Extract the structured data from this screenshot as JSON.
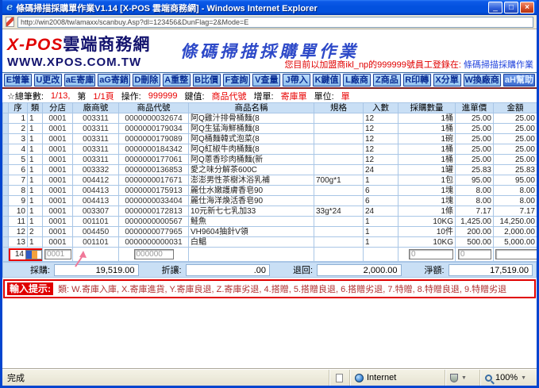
{
  "window": {
    "title": "條碼掃描採購單作業V1.14 [X-POS 雲端商務網] - Windows Internet Explorer",
    "minimize": "_",
    "maximize": "□",
    "close": "×"
  },
  "address": {
    "url": "http://win2008/tw/amaxx/scanbuy.Asp?dl=123456&DunFlag=2&Mode=E"
  },
  "header": {
    "logo_main_red": "X-POS",
    "logo_main_black": "雲端商務網",
    "logo_sub": "WWW.XPOS.COM.TW",
    "page_title": "條碼掃描採購單作業",
    "login_prefix": "您目前以加盟商ikl_np的999999號員工登錄在: ",
    "login_location": "條碼掃描採購作業"
  },
  "toolbar": {
    "buttons": [
      {
        "label": "E增筆"
      },
      {
        "label": "U更改"
      },
      {
        "label": "aE寄庫"
      },
      {
        "label": "aG寄銷"
      },
      {
        "label": "D刪除"
      },
      {
        "label": "A重整"
      },
      {
        "label": "B比價"
      },
      {
        "label": "F查詢"
      },
      {
        "label": "V查量"
      },
      {
        "label": "J帶入"
      },
      {
        "label": "K鍵值"
      },
      {
        "label": "L廠商"
      },
      {
        "label": "Z商品"
      },
      {
        "label": "R印轉"
      },
      {
        "label": "X分單"
      },
      {
        "label": "W換廠商"
      },
      {
        "label": "aH幫助",
        "cls": "help"
      }
    ]
  },
  "statusline": {
    "segments": [
      {
        "t": "☆總筆數:",
        "c": "k"
      },
      {
        "t": "1/13,",
        "c": "r"
      },
      {
        "t": "第",
        "c": "k"
      },
      {
        "t": "1/1頁",
        "c": "r"
      },
      {
        "t": "操作:",
        "c": "k"
      },
      {
        "t": "999999",
        "c": "r"
      },
      {
        "t": "鍵值:",
        "c": "k"
      },
      {
        "t": "商品代號",
        "c": "r"
      },
      {
        "t": "增單:",
        "c": "k"
      },
      {
        "t": "寄庫單",
        "c": "r"
      },
      {
        "t": "單位:",
        "c": "k"
      },
      {
        "t": "單",
        "c": "r"
      }
    ]
  },
  "table": {
    "headers": [
      "序",
      "類",
      "分店",
      "廠商號",
      "商品代號",
      "商品名稱",
      "規格",
      "入數",
      "採購數量",
      "進單價",
      "金額"
    ],
    "rows": [
      {
        "seq": "1",
        "type": "1",
        "store": "0001",
        "vendor": "003311",
        "code": "0000000032674",
        "name": "阿Q雞汁排骨桶麵(8",
        "spec": "",
        "innum": "12",
        "qty": "1桶",
        "price": "25.00",
        "amount": "25.00"
      },
      {
        "seq": "2",
        "type": "1",
        "store": "0001",
        "vendor": "003311",
        "code": "0000000179034",
        "name": "阿Q生猛海鮮桶麵(8",
        "spec": "",
        "innum": "12",
        "qty": "1桶",
        "price": "25.00",
        "amount": "25.00"
      },
      {
        "seq": "3",
        "type": "1",
        "store": "0001",
        "vendor": "003311",
        "code": "0000000179089",
        "name": "阿Q桶麵韓式泡菜(8",
        "spec": "",
        "innum": "12",
        "qty": "1碗",
        "price": "25.00",
        "amount": "25.00"
      },
      {
        "seq": "4",
        "type": "1",
        "store": "0001",
        "vendor": "003311",
        "code": "0000000184342",
        "name": "阿Q紅椒牛肉桶麵(8",
        "spec": "",
        "innum": "12",
        "qty": "1桶",
        "price": "25.00",
        "amount": "25.00"
      },
      {
        "seq": "5",
        "type": "1",
        "store": "0001",
        "vendor": "003311",
        "code": "0000000177061",
        "name": "阿Q蔥香珍肉桶麵(新",
        "spec": "",
        "innum": "12",
        "qty": "1桶",
        "price": "25.00",
        "amount": "25.00"
      },
      {
        "seq": "6",
        "type": "1",
        "store": "0001",
        "vendor": "003332",
        "code": "0000000136853",
        "name": "愛之味分解茶600C",
        "spec": "",
        "innum": "24",
        "qty": "1罐",
        "price": "25.83",
        "amount": "25.83"
      },
      {
        "seq": "7",
        "type": "1",
        "store": "0001",
        "vendor": "004412",
        "code": "0000000017671",
        "name": "澎澎男性茶樹沐浴乳補",
        "spec": "700g*1",
        "innum": "1",
        "qty": "1包",
        "price": "95.00",
        "amount": "95.00"
      },
      {
        "seq": "8",
        "type": "1",
        "store": "0001",
        "vendor": "004413",
        "code": "0000000175913",
        "name": "麗仕水嫩護膚香皂90",
        "spec": "",
        "innum": "6",
        "qty": "1塊",
        "price": "8.00",
        "amount": "8.00"
      },
      {
        "seq": "9",
        "type": "1",
        "store": "0001",
        "vendor": "004413",
        "code": "0000000033404",
        "name": "麗仕海洋煥活香皂90",
        "spec": "",
        "innum": "6",
        "qty": "1塊",
        "price": "8.00",
        "amount": "8.00"
      },
      {
        "seq": "10",
        "type": "1",
        "store": "0001",
        "vendor": "003307",
        "code": "0000000172813",
        "name": "10元新七七乳加33",
        "spec": "33g*24",
        "innum": "24",
        "qty": "1條",
        "price": "7.17",
        "amount": "7.17"
      },
      {
        "seq": "11",
        "type": "1",
        "store": "0001",
        "vendor": "001101",
        "code": "0000000000567",
        "name": "鮭魚",
        "spec": "",
        "innum": "1",
        "qty": "10KG",
        "price": "1,425.00",
        "amount": "14,250.00"
      },
      {
        "seq": "12",
        "type": "2",
        "store": "0001",
        "vendor": "004450",
        "code": "0000000077965",
        "name": "VH9604抽針V領",
        "spec": "",
        "innum": "1",
        "qty": "10件",
        "price": "200.00",
        "amount": "2,000.00"
      },
      {
        "seq": "13",
        "type": "1",
        "store": "0001",
        "vendor": "001101",
        "code": "0000000000031",
        "name": "白鯧",
        "spec": "",
        "innum": "1",
        "qty": "10KG",
        "price": "500.00",
        "amount": "5,000.00"
      }
    ]
  },
  "input_row": {
    "seq": "14",
    "type_value": "",
    "store": "0001",
    "code": "000000",
    "qty": "0",
    "price": "0"
  },
  "totals": {
    "purchase_label": "採購:",
    "purchase": "19,519.00",
    "discount_label": "折讓:",
    "discount": ".00",
    "returns_label": "退回:",
    "returns": "2,000.00",
    "net_label": "淨額:",
    "net": "17,519.00"
  },
  "hint": {
    "label": "輸入提示:",
    "text": "類: W.寄庫入庫, X.寄庫進貨, Y.寄庫良退, Z.寄庫劣退, 4.搭贈, 5.搭贈良退, 6.搭贈劣退, 7.特贈, 8.特贈良退, 9.特贈劣退"
  },
  "statusbar": {
    "status": "完成",
    "zone": "Internet",
    "zoom": "100%"
  }
}
